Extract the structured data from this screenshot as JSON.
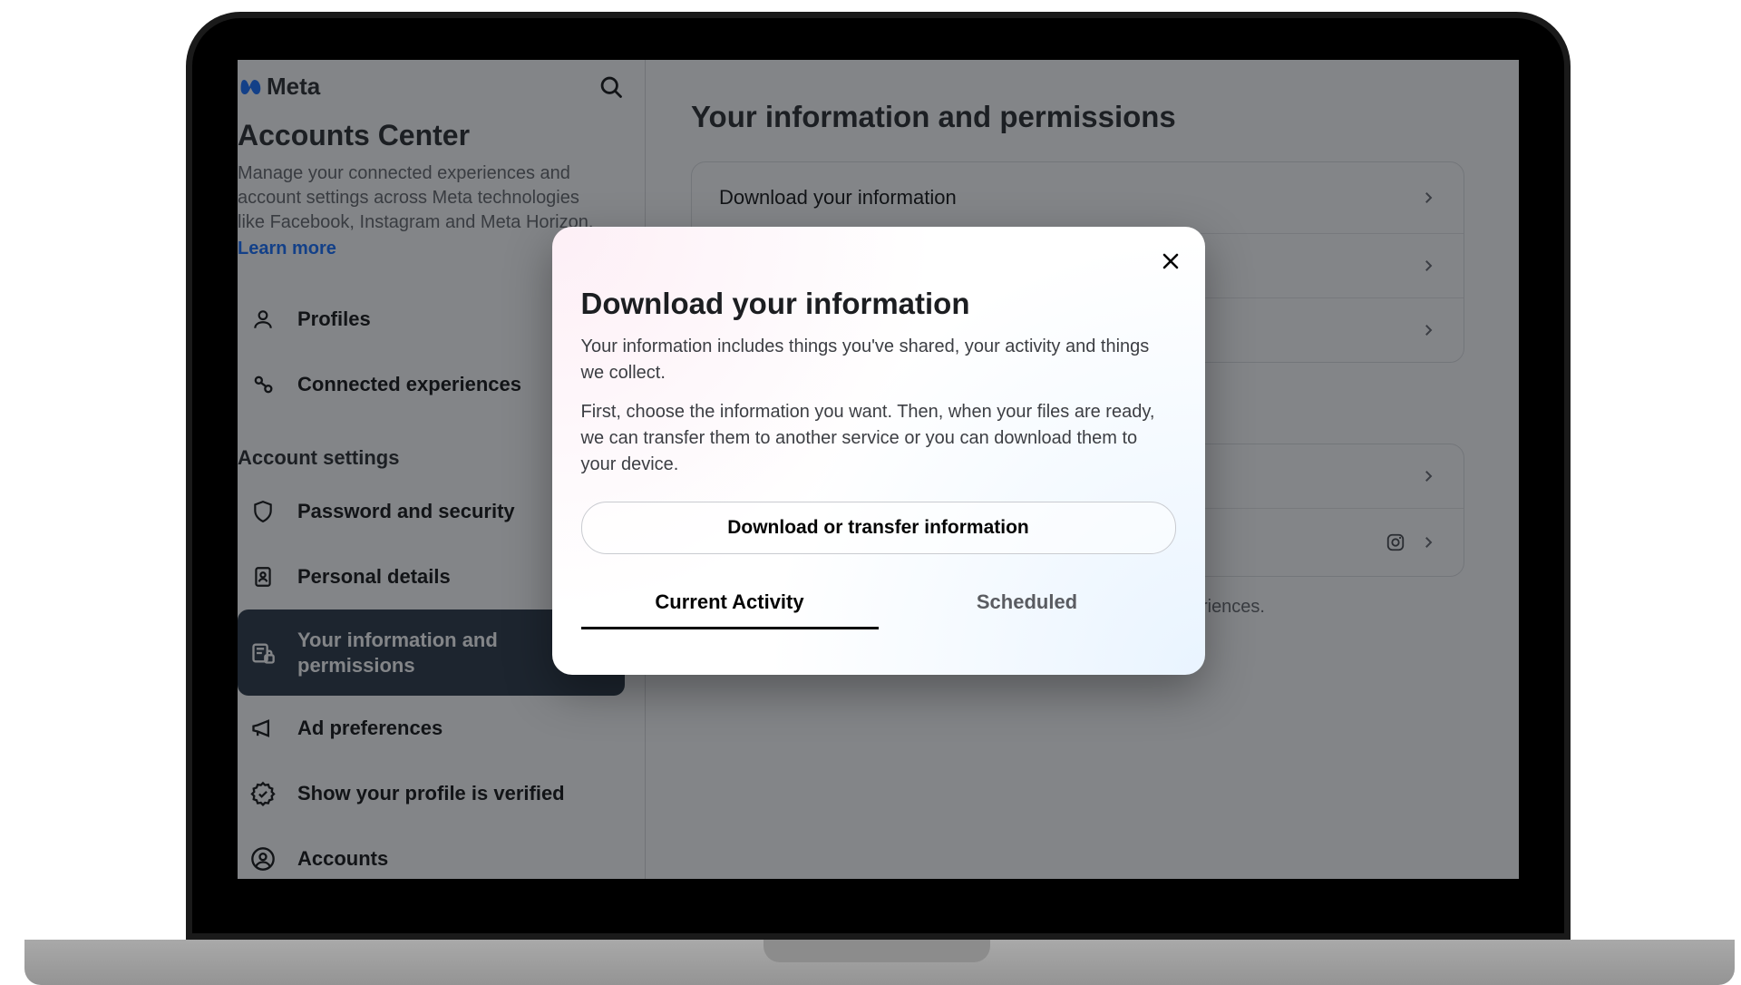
{
  "brand": {
    "name": "Meta"
  },
  "sidebar": {
    "title": "Accounts Center",
    "description": "Manage your connected experiences and account settings across Meta technologies like Facebook, Instagram and Meta Horizon.",
    "learn_more": "Learn more",
    "top_items": [
      {
        "label": "Profiles"
      },
      {
        "label": "Connected experiences"
      }
    ],
    "section_label": "Account settings",
    "settings_items": [
      {
        "label": "Password and security"
      },
      {
        "label": "Personal details"
      },
      {
        "label": "Your information and permissions"
      },
      {
        "label": "Ad preferences"
      },
      {
        "label": "Show your profile is verified"
      },
      {
        "label": "Accounts"
      }
    ]
  },
  "main": {
    "title": "Your information and permissions",
    "rows": [
      {
        "label": "Download your information"
      },
      {
        "label": ""
      },
      {
        "label": ""
      }
    ],
    "note_tail": "ur experiences."
  },
  "modal": {
    "title": "Download your information",
    "p1": "Your information includes things you've shared, your activity and things we collect.",
    "p2": "First, choose the information you want. Then, when your files are ready, we can transfer them to another service or you can download them to your device.",
    "button": "Download or transfer information",
    "tabs": {
      "current": "Current Activity",
      "scheduled": "Scheduled"
    }
  }
}
